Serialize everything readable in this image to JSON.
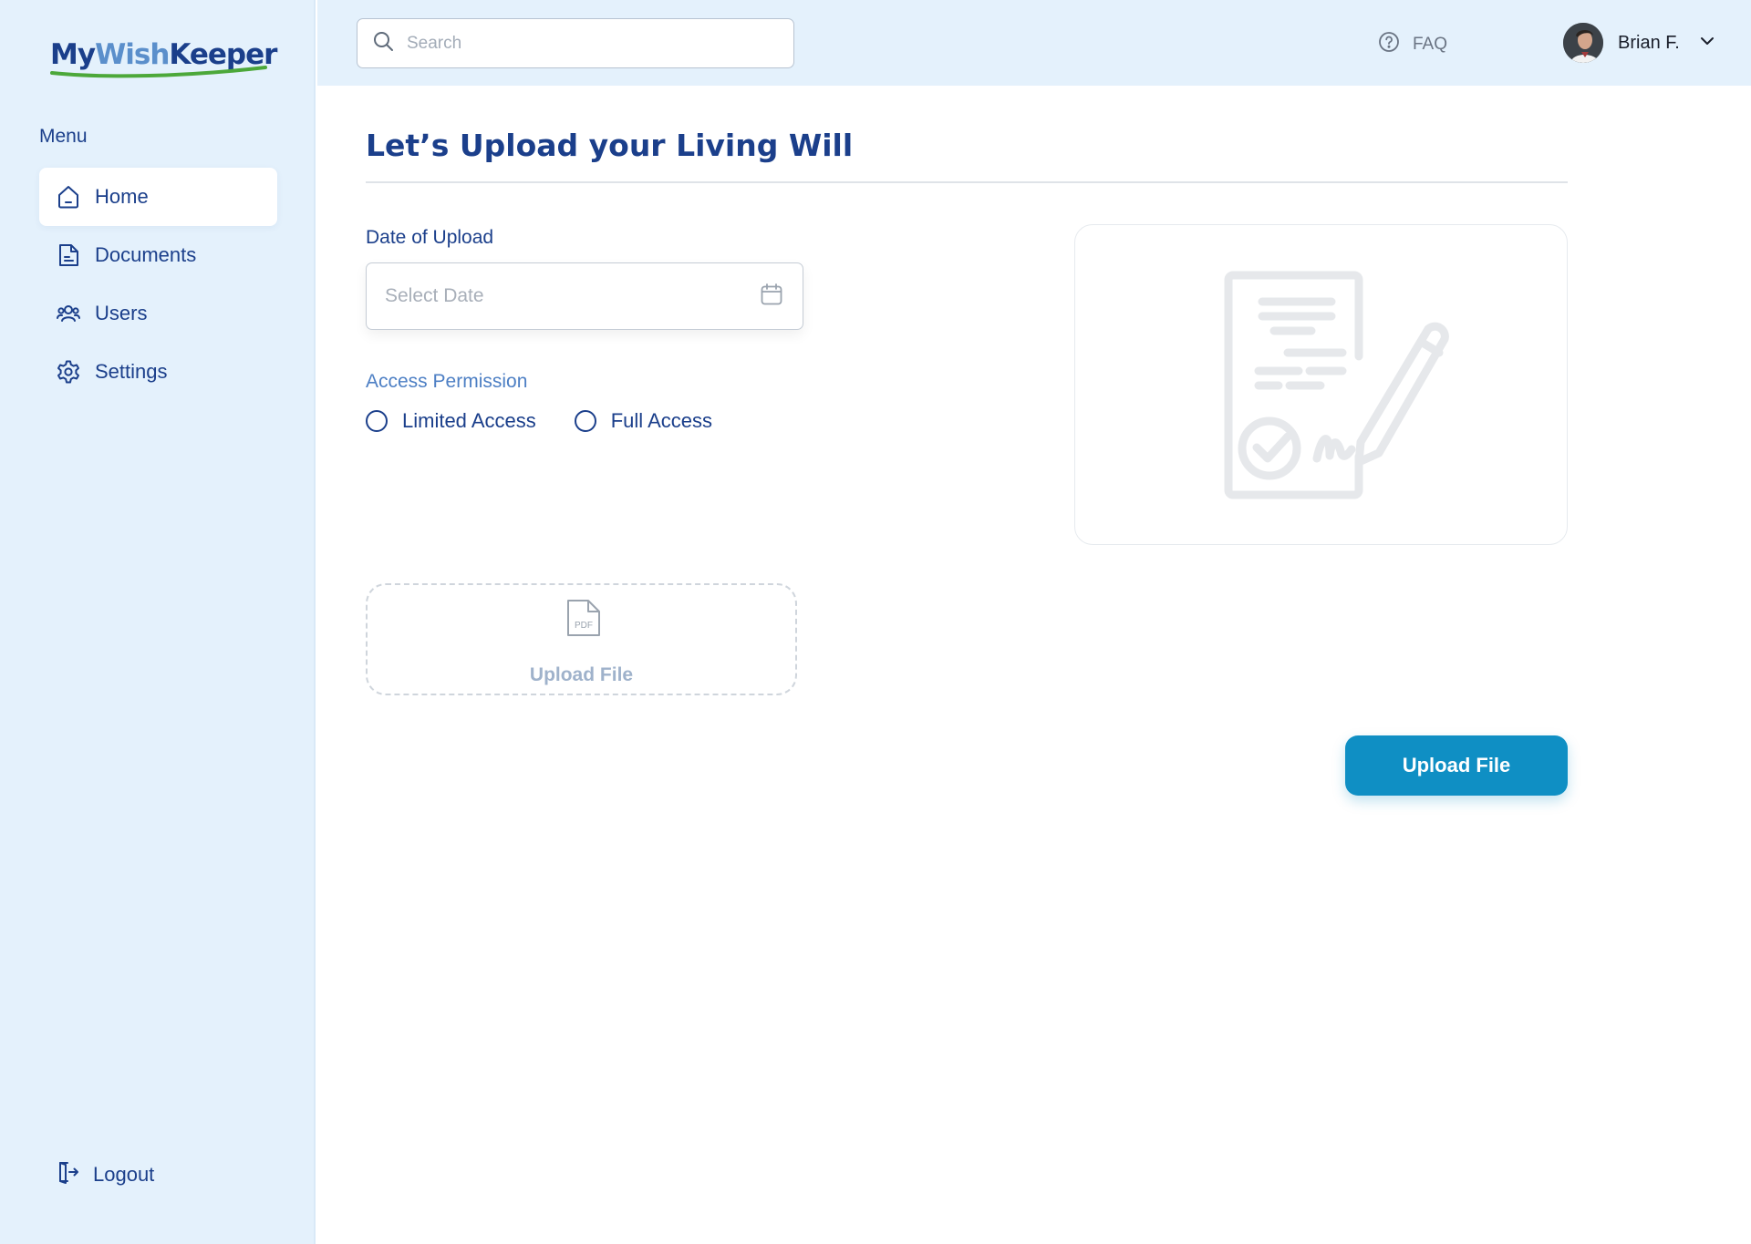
{
  "brand": {
    "logo_part1": "My",
    "logo_part2": "Wish",
    "logo_part3": "Keeper"
  },
  "sidebar": {
    "menu_heading": "Menu",
    "items": [
      {
        "label": "Home",
        "icon": "home-icon",
        "active": true
      },
      {
        "label": "Documents",
        "icon": "document-icon",
        "active": false
      },
      {
        "label": "Users",
        "icon": "users-icon",
        "active": false
      },
      {
        "label": "Settings",
        "icon": "gear-icon",
        "active": false
      }
    ],
    "logout_label": "Logout"
  },
  "topbar": {
    "search_placeholder": "Search",
    "faq_label": "FAQ",
    "user_name": "Brian F."
  },
  "main": {
    "title": "Let’s Upload your Living Will",
    "date_label": "Date of Upload",
    "date_placeholder": "Select Date",
    "permission_label": "Access Permission",
    "permission_options": [
      "Limited Access",
      "Full Access"
    ],
    "dropzone_badge": "PDF",
    "dropzone_label": "Upload File",
    "upload_button_label": "Upload File"
  },
  "colors": {
    "primary": "#1b3f8b",
    "accent": "#0f8fc4",
    "sidebar_bg": "#e4f1fc",
    "logo_green": "#4ca83a"
  }
}
